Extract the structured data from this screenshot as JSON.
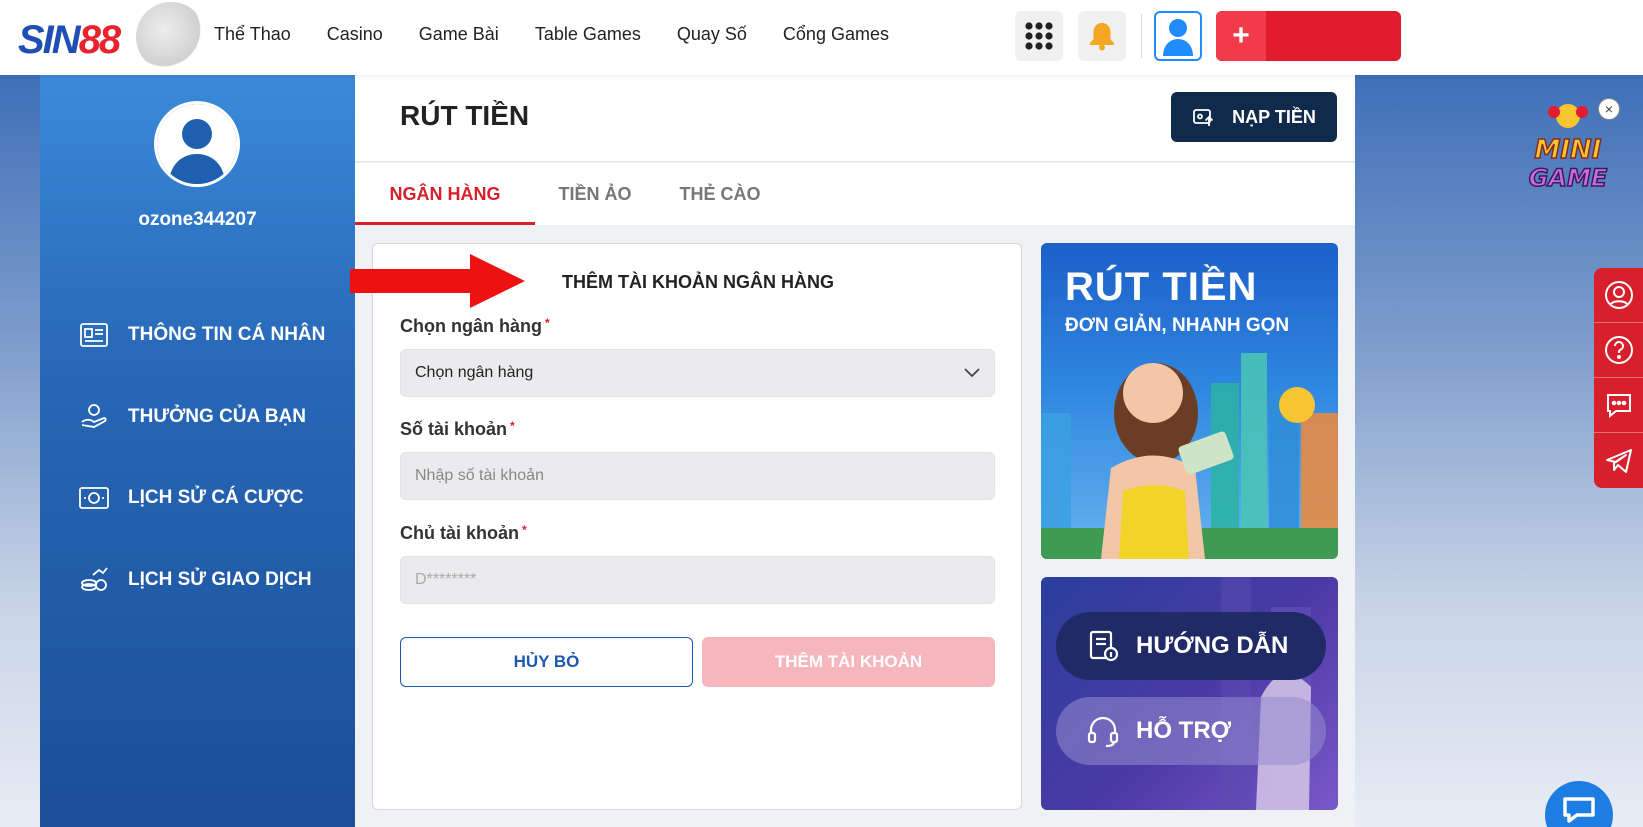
{
  "header": {
    "logo": {
      "text_a": "SIN",
      "text_b": "88"
    },
    "nav": [
      "Thể Thao",
      "Casino",
      "Game Bài",
      "Table Games",
      "Quay Số",
      "Cổng Games"
    ],
    "deposit_plus": "+"
  },
  "sidebar": {
    "username": "ozone344207",
    "items": [
      {
        "label": "THÔNG TIN CÁ NHÂN",
        "icon": "profile-card-icon"
      },
      {
        "label": "THƯỞNG CỦA BẠN",
        "icon": "gift-hand-icon"
      },
      {
        "label": "LỊCH SỬ CÁ CƯỢC",
        "icon": "money-bill-icon"
      },
      {
        "label": "LỊCH SỬ GIAO DỊCH",
        "icon": "coins-chart-icon"
      }
    ]
  },
  "main": {
    "title": "RÚT TIỀN",
    "deposit_button": "NẠP TIỀN",
    "tabs": [
      {
        "label": "NGÂN HÀNG",
        "active": true
      },
      {
        "label": "TIỀN ẢO",
        "active": false
      },
      {
        "label": "THẺ CÀO",
        "active": false
      }
    ]
  },
  "form": {
    "heading": "THÊM TÀI KHOẢN NGÂN HÀNG",
    "bank_label": "Chọn ngân hàng",
    "bank_value": "Chọn ngân hàng",
    "account_label": "Số tài khoản",
    "account_placeholder": "Nhập số tài khoản",
    "holder_label": "Chủ tài khoản",
    "holder_value": "D********",
    "required_mark": "*",
    "cancel_button": "HỦY BỎ",
    "add_button": "THÊM TÀI KHOẢN"
  },
  "promo": {
    "title": "RÚT TIỀN",
    "subtitle": "ĐƠN GIẢN, NHANH GỌN",
    "guide": "HƯỚNG DẪN",
    "support": "HỖ TRỢ"
  },
  "minigame": {
    "line1": "MINI",
    "line2": "GAME",
    "close": "×"
  },
  "colors": {
    "brand_red": "#e21b2d",
    "brand_blue": "#1f4fb3",
    "navy": "#0f2a4a",
    "sidebar_blue": "#2767b6",
    "disabled_pink": "#f5b7bd"
  }
}
